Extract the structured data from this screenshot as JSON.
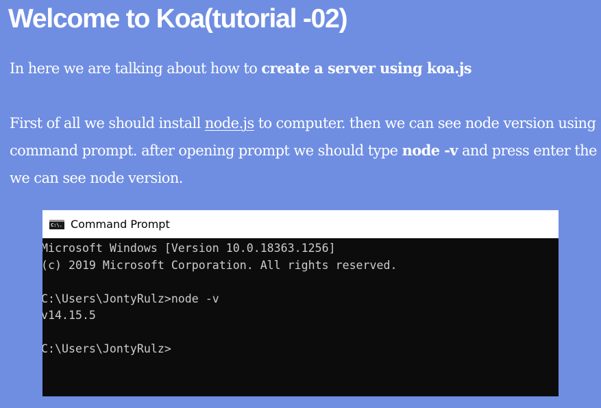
{
  "article": {
    "title": "Welcome to Koa(tutorial -02)",
    "intro": {
      "text": "In here we are talking about how to ",
      "bold": "create a server using koa.js"
    },
    "install": {
      "text1": "First of all we should install ",
      "link": "node.js",
      "text2": " to computer. then we can see node version using command prompt. after opening prompt we should type ",
      "bold": "node -v",
      "text3": " and press enter the we can see node version."
    }
  },
  "terminal": {
    "title": "Command Prompt",
    "icon": "cmd-icon",
    "icon_text": "C:\\.",
    "lines": [
      "Microsoft Windows [Version 10.0.18363.1256]",
      "(c) 2019 Microsoft Corporation. All rights reserved.",
      "",
      "C:\\Users\\JontyRulz>node -v",
      "v14.15.5",
      "",
      "C:\\Users\\JontyRulz>"
    ]
  },
  "colors": {
    "background": "#6f8ee2",
    "text": "#ffffff",
    "terminal_background": "#0c0c0c",
    "terminal_text": "#cccccc",
    "titlebar": "#ffffff"
  }
}
